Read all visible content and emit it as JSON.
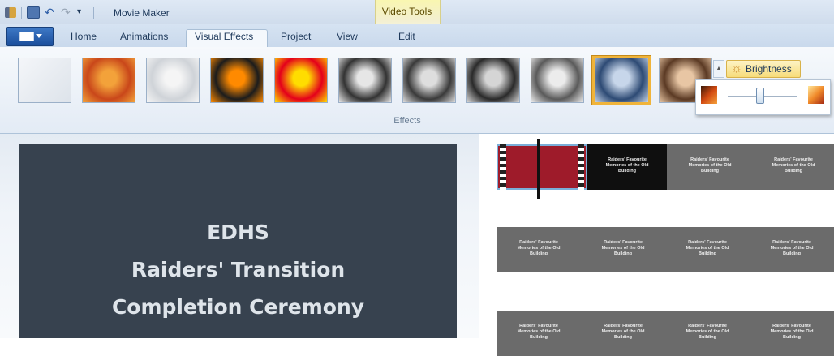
{
  "window": {
    "title": "Movie Maker",
    "contextual_group": "Video Tools"
  },
  "tabs": [
    {
      "label": "Home"
    },
    {
      "label": "Animations"
    },
    {
      "label": "Visual Effects",
      "active": true
    },
    {
      "label": "Project"
    },
    {
      "label": "View"
    },
    {
      "label": "Edit"
    }
  ],
  "ribbon": {
    "effects_group_label": "Effects",
    "effects": [
      {
        "name": "No effect",
        "colors": [
          "#f4f6f9",
          "#dde3ea"
        ]
      },
      {
        "name": "Blur",
        "colors": [
          "#f3a23a",
          "#c9471a"
        ]
      },
      {
        "name": "Edge detection",
        "colors": [
          "#f5f5f5",
          "#cfd3d8"
        ]
      },
      {
        "name": "Threshold",
        "colors": [
          "#ff8a00",
          "#1c1c1c"
        ]
      },
      {
        "name": "Posterize",
        "colors": [
          "#ffdd00",
          "#e4001b"
        ]
      },
      {
        "name": "Black and white",
        "colors": [
          "#e6e6e6",
          "#333333"
        ]
      },
      {
        "name": "Black and white orange",
        "colors": [
          "#dedede",
          "#3a3a3a"
        ]
      },
      {
        "name": "Black and white red",
        "colors": [
          "#d5d5d5",
          "#2a2a2a"
        ]
      },
      {
        "name": "Black and white yellow",
        "colors": [
          "#ececec",
          "#5a5a5a"
        ]
      },
      {
        "name": "Cyanotype",
        "colors": [
          "#c7d6ea",
          "#2d4a74"
        ],
        "selected": true
      },
      {
        "name": "Sepia",
        "colors": [
          "#e8c6a4",
          "#5b3a24"
        ]
      }
    ],
    "brightness_label": "Brightness",
    "brightness_value": 0.47
  },
  "preview": {
    "lines": [
      "EDHS",
      "Raiders' Transition",
      "Completion Ceremony"
    ]
  },
  "storyboard": {
    "caption_lines": [
      "Raiders' Favourite",
      "Memories of the Old",
      "Building"
    ],
    "row_count": 3
  },
  "colors": {
    "accent": "#2b6fc5",
    "selected_effect_border": "#f0b43a",
    "preview_bg": "#37424f"
  }
}
